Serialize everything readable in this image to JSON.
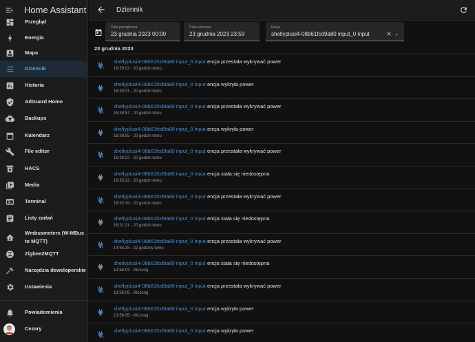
{
  "app": {
    "title": "Home Assistant"
  },
  "sidebar": {
    "items": [
      {
        "label": "Przegląd",
        "icon": "view-dashboard-icon"
      },
      {
        "label": "Energia",
        "icon": "lightning-bolt-icon"
      },
      {
        "label": "Mapa",
        "icon": "account-box-icon"
      },
      {
        "label": "Dziennik",
        "icon": "format-list-bulleted-icon",
        "active": true
      },
      {
        "label": "Historia",
        "icon": "chart-box-icon"
      },
      {
        "label": "AdGuard Home",
        "icon": "shield-check-icon"
      },
      {
        "label": "Backups",
        "icon": "cloud-upload-icon"
      },
      {
        "label": "Kalendarz",
        "icon": "calendar-icon"
      },
      {
        "label": "File editor",
        "icon": "wrench-icon"
      },
      {
        "label": "HACS",
        "icon": "hacs-icon"
      },
      {
        "label": "Media",
        "icon": "play-box-multiple-icon"
      },
      {
        "label": "Terminal",
        "icon": "console-icon"
      },
      {
        "label": "Listy zadań",
        "icon": "clipboard-list-icon"
      },
      {
        "label": "Wmbusmeters (W-MBus to MQTT)",
        "label_line1": "Wmbusmeters (W-MBus",
        "label_line2": "to MQTT)",
        "icon": "home-thermometer-icon"
      },
      {
        "label": "Zigbee2MQTT",
        "icon": "zigbee-icon"
      },
      {
        "label": "Narzędzia deweloperskie",
        "icon": "hammer-icon"
      },
      {
        "label": "Ustawienia",
        "icon": "cog-icon"
      }
    ],
    "notifications": {
      "label": "Powiadomienia",
      "icon": "bell-icon"
    },
    "user": {
      "label": "Cezary",
      "icon": "avatar-icon"
    }
  },
  "toolbar": {
    "title": "Dziennik",
    "back_icon": "arrow-left-icon",
    "refresh_icon": "refresh-icon"
  },
  "filters": {
    "start": {
      "label": "Data początkowa",
      "value": "23 grudnia 2023 00:00"
    },
    "end": {
      "label": "Data końcowa",
      "value": "23 grudnia 2023 23:59"
    },
    "entity": {
      "label": "Encja",
      "value": "shellyplusi4-08b61fcd9a80 input_0 input"
    }
  },
  "date_header": "23 grudnia 2023",
  "entries": [
    {
      "entity": "shellyplusi4-08b61fcd9a80 input_0 input",
      "message": "encja przestała wykrywać power",
      "time": "16:39:02 - 20 godzin temu",
      "icon": "power-plug-off-icon"
    },
    {
      "entity": "shellyplusi4-08b61fcd9a80 input_0 input",
      "message": "encja wykryła power",
      "time": "16:39:01 - 20 godzin temu",
      "icon": "power-plug-icon"
    },
    {
      "entity": "shellyplusi4-08b61fcd9a80 input_0 input",
      "message": "encja przestała wykrywać power",
      "time": "16:38:57 - 20 godzin temu",
      "icon": "power-plug-off-icon"
    },
    {
      "entity": "shellyplusi4-08b61fcd9a80 input_0 input",
      "message": "encja wykryła power",
      "time": "16:38:55 - 20 godzin temu",
      "icon": "power-plug-icon"
    },
    {
      "entity": "shellyplusi4-08b61fcd9a80 input_0 input",
      "message": "encja przestała wykrywać power",
      "time": "16:38:22 - 20 godzin temu",
      "icon": "power-plug-off-icon"
    },
    {
      "entity": "shellyplusi4-08b61fcd9a80 input_0 input",
      "message": "encja stała się niedostępna",
      "time": "16:35:22 - 20 godzin temu",
      "icon": "power-plug-gray-icon"
    },
    {
      "entity": "shellyplusi4-08b61fcd9a80 input_0 input",
      "message": "encja przestała wykrywać power",
      "time": "16:33:19 - 20 godzin temu",
      "icon": "power-plug-off-icon"
    },
    {
      "entity": "shellyplusi4-08b61fcd9a80 input_0 input",
      "message": "encja stała się niedostępna",
      "time": "16:21:21 - 20 godzin temu",
      "icon": "power-plug-gray-icon"
    },
    {
      "entity": "shellyplusi4-08b61fcd9a80 input_0 input",
      "message": "encja przestała wykrywać power",
      "time": "14:54:25 - 22 godziny temu",
      "icon": "power-plug-off-icon"
    },
    {
      "entity": "shellyplusi4-08b61fcd9a80 input_0 input",
      "message": "encja stała się niedostępna",
      "time": "13:58:03 - Wczoraj",
      "icon": "power-plug-gray-icon"
    },
    {
      "entity": "shellyplusi4-08b61fcd9a80 input_0 input",
      "message": "encja przestała wykrywać power",
      "time": "13:56:05 - Wczoraj",
      "icon": "power-plug-off-icon"
    },
    {
      "entity": "shellyplusi4-08b61fcd9a80 input_0 input",
      "message": "encja wykryła power",
      "time": "13:56:05 - Wczoraj",
      "icon": "power-plug-icon"
    },
    {
      "entity": "shellyplusi4-08b61fcd9a80 input_0 input",
      "message": "encja wykryła power",
      "time": "",
      "icon": "power-plug-off-icon"
    }
  ],
  "colors": {
    "accent": "#4f8fc9",
    "active": "#55a8e2",
    "icon_blue": "#4a85c4",
    "icon_gray": "#8a8a8a",
    "background": "#111111",
    "sidebar": "#1c1c1c"
  }
}
